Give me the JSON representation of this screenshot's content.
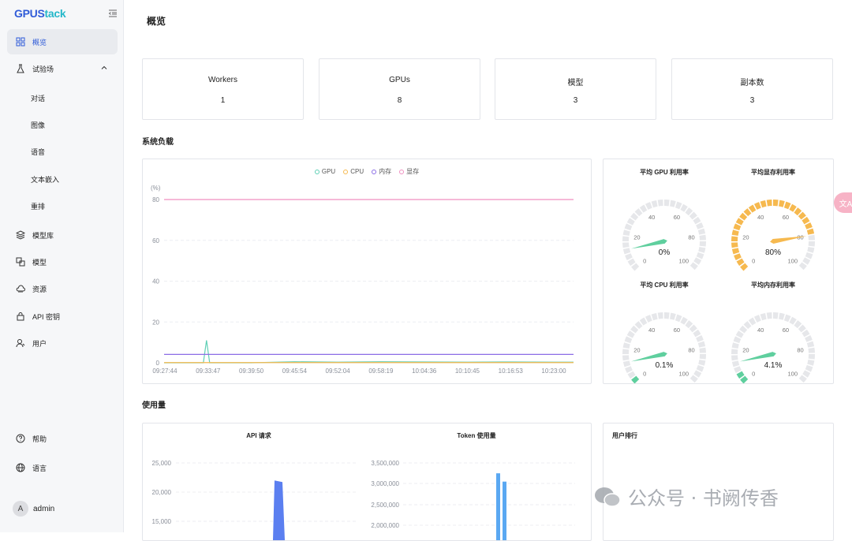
{
  "app": {
    "logo_main": "GPUS",
    "logo_accent": "tack"
  },
  "sidebar": {
    "items": [
      {
        "label": "概览",
        "icon": "grid-icon",
        "active": true
      },
      {
        "label": "试验场",
        "icon": "flask-icon",
        "expanded": true
      },
      {
        "label": "对话"
      },
      {
        "label": "图像"
      },
      {
        "label": "语音"
      },
      {
        "label": "文本嵌入"
      },
      {
        "label": "重排"
      },
      {
        "label": "模型库",
        "icon": "layers-icon"
      },
      {
        "label": "模型",
        "icon": "model-icon"
      },
      {
        "label": "资源",
        "icon": "cloud-icon"
      },
      {
        "label": "API 密钥",
        "icon": "lock-icon"
      },
      {
        "label": "用户",
        "icon": "user-icon"
      }
    ],
    "help_label": "帮助",
    "language_label": "语言",
    "user": {
      "avatar_letter": "A",
      "name": "admin"
    }
  },
  "main": {
    "title": "概览",
    "stats": [
      {
        "label": "Workers",
        "value": "1"
      },
      {
        "label": "GPUs",
        "value": "8"
      },
      {
        "label": "模型",
        "value": "3"
      },
      {
        "label": "副本数",
        "value": "3"
      }
    ],
    "system_load_title": "系统负载",
    "usage_title": "使用量",
    "user_rank_title": "用户排行"
  },
  "gauges": [
    {
      "title": "平均 GPU 利用率",
      "value": 0,
      "display": "0%",
      "color": "#5fcf9e"
    },
    {
      "title": "平均显存利用率",
      "value": 80,
      "display": "80%",
      "color": "#f6b94f"
    },
    {
      "title": "平均 CPU 利用率",
      "value": 0.1,
      "display": "0.1%",
      "color": "#5fcf9e"
    },
    {
      "title": "平均内存利用率",
      "value": 4.1,
      "display": "4.1%",
      "color": "#5fcf9e"
    }
  ],
  "gauge_ticks": [
    "0",
    "20",
    "40",
    "60",
    "80",
    "100"
  ],
  "chart_data": [
    {
      "type": "line",
      "title": "",
      "ylabel": "(%)",
      "ylim": [
        0,
        80
      ],
      "yticks": [
        0,
        20,
        40,
        60,
        80
      ],
      "x": [
        "09:27:44",
        "09:33:47",
        "09:39:50",
        "09:45:54",
        "09:52:04",
        "09:58:19",
        "10:04:36",
        "10:10:45",
        "10:16:53",
        "10:23:00"
      ],
      "grid": true,
      "legend_position": "top-center",
      "series": [
        {
          "name": "GPU",
          "color": "#5fcfb5",
          "values": [
            0,
            11,
            0,
            0.5,
            0.3,
            0.5,
            0.4,
            0.3,
            0.4,
            0.3
          ]
        },
        {
          "name": "CPU",
          "color": "#f6b94f",
          "values": [
            0.1,
            0.1,
            0.1,
            0.1,
            0.1,
            0.1,
            0.1,
            0.1,
            0.1,
            0.1
          ]
        },
        {
          "name": "内存",
          "color": "#8b6ce6",
          "values": [
            4.1,
            4.1,
            4.1,
            4.1,
            4.1,
            4.1,
            4.1,
            4.1,
            4.1,
            4.1
          ]
        },
        {
          "name": "显存",
          "color": "#f08fc0",
          "values": [
            80,
            80,
            80,
            80,
            80,
            80,
            80,
            80,
            80,
            80
          ]
        }
      ]
    },
    {
      "type": "area",
      "title": "API 请求",
      "yticks": [
        "25,000",
        "20,000",
        "15,000"
      ],
      "ylim": [
        10000,
        25000
      ],
      "peak_value": 22000,
      "color": "#5b7ff0"
    },
    {
      "type": "bar",
      "title": "Token 使用量",
      "yticks": [
        "3,500,000",
        "3,000,000",
        "2,500,000",
        "2,000,000"
      ],
      "ylim": [
        1500000,
        3500000
      ],
      "values": [
        3250000,
        3050000
      ],
      "color": "#5aa8f2"
    }
  ],
  "watermark": "公众号 · 书阙传香"
}
